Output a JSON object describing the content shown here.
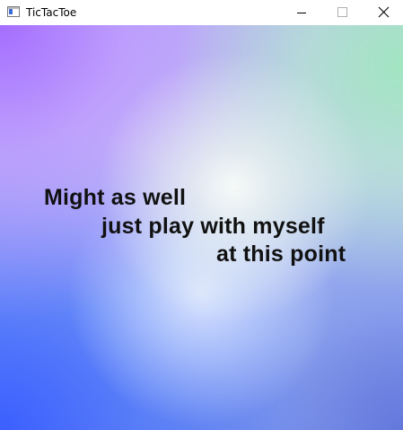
{
  "window": {
    "title": "TicTacToe",
    "controls": {
      "minimize_icon": "minimize-icon",
      "maximize_icon": "maximize-icon",
      "close_icon": "close-icon"
    }
  },
  "canvas": {
    "message_lines": [
      "Might as well",
      "just play with myself",
      "at this point"
    ],
    "text_color": "#111111",
    "gradient_colors": {
      "top_left": "#9f6cff",
      "top_right": "#a6e8c4",
      "center": "#f3f8f4",
      "bottom_left": "#3c5fff",
      "bottom_right": "#6b80dc"
    }
  }
}
